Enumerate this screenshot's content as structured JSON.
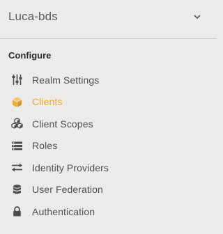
{
  "realm": {
    "name": "Luca-bds",
    "chevron_icon": "chevron-down-icon"
  },
  "section": {
    "title": "Configure"
  },
  "nav": {
    "items": [
      {
        "label": "Realm Settings",
        "icon": "sliders-icon",
        "active": false
      },
      {
        "label": "Clients",
        "icon": "cube-icon",
        "active": true
      },
      {
        "label": "Client Scopes",
        "icon": "cubes-icon",
        "active": false
      },
      {
        "label": "Roles",
        "icon": "list-icon",
        "active": false
      },
      {
        "label": "Identity Providers",
        "icon": "exchange-arrows-icon",
        "active": false
      },
      {
        "label": "User Federation",
        "icon": "database-icon",
        "active": false
      },
      {
        "label": "Authentication",
        "icon": "lock-icon",
        "active": false
      }
    ]
  },
  "colors": {
    "background": "#ebebeb",
    "accent": "#f0a830",
    "text": "#4f4f4f",
    "icon": "#4d4d4d",
    "divider": "#cfcfcf"
  }
}
